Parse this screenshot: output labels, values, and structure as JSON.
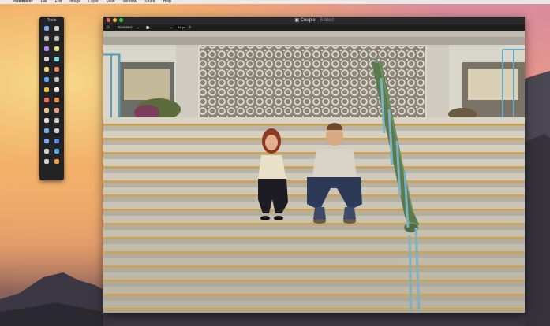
{
  "menubar": {
    "apple": "",
    "app_name": "Pixelmator",
    "items": [
      "File",
      "Edit",
      "Image",
      "Layer",
      "View",
      "Window",
      "Share",
      "Help"
    ]
  },
  "tools_panel": {
    "title": "Tools",
    "tools": [
      {
        "name": "move-tool",
        "color": "#7aa6e8"
      },
      {
        "name": "arrow-tool",
        "color": "#cfcfcf"
      },
      {
        "name": "rect-select-tool",
        "color": "#bdbdbd"
      },
      {
        "name": "lasso-tool",
        "color": "#bdbdbd"
      },
      {
        "name": "magic-wand-tool",
        "color": "#b58af0"
      },
      {
        "name": "quick-select-tool",
        "color": "#e8e07a"
      },
      {
        "name": "crop-tool",
        "color": "#cfcfcf"
      },
      {
        "name": "eyedropper-tool",
        "color": "#7ad6e8"
      },
      {
        "name": "pencil-tool",
        "color": "#f0d070"
      },
      {
        "name": "brush-tool",
        "color": "#f08a5a"
      },
      {
        "name": "shape-tool",
        "color": "#5aa6f0"
      },
      {
        "name": "gear-tool",
        "color": "#c0c0c0"
      },
      {
        "name": "paint-bucket-tool",
        "color": "#f0c040"
      },
      {
        "name": "clone-tool",
        "color": "#f0f0f0"
      },
      {
        "name": "eraser-tool",
        "color": "#f06a5a"
      },
      {
        "name": "burn-tool",
        "color": "#f08a40"
      },
      {
        "name": "sponge-tool",
        "color": "#f0c090"
      },
      {
        "name": "smudge-tool",
        "color": "#f0a080"
      },
      {
        "name": "red-eye-tool",
        "color": "#e0e0e0"
      },
      {
        "name": "sharpen-tool",
        "color": "#d0d0d0"
      },
      {
        "name": "blur-tool",
        "color": "#6ab0f0"
      },
      {
        "name": "dodge-tool",
        "color": "#d0d0d0"
      },
      {
        "name": "pen-tool",
        "color": "#7aa6e8"
      },
      {
        "name": "gradient-tool",
        "color": "#5a8af0"
      },
      {
        "name": "type-tool",
        "color": "#d0d0d0"
      },
      {
        "name": "heart-shape-tool",
        "color": "#5ab0f0"
      },
      {
        "name": "hand-tool",
        "color": "#d0d0d0"
      },
      {
        "name": "zoom-tool",
        "color": "#f0a040"
      }
    ]
  },
  "window": {
    "title": "Couple",
    "status": "Edited",
    "toolbar": {
      "tool_icon": "⊙",
      "diameter_label": "Diameter:",
      "diameter_value": "41 px",
      "stepper": "⇕"
    }
  }
}
